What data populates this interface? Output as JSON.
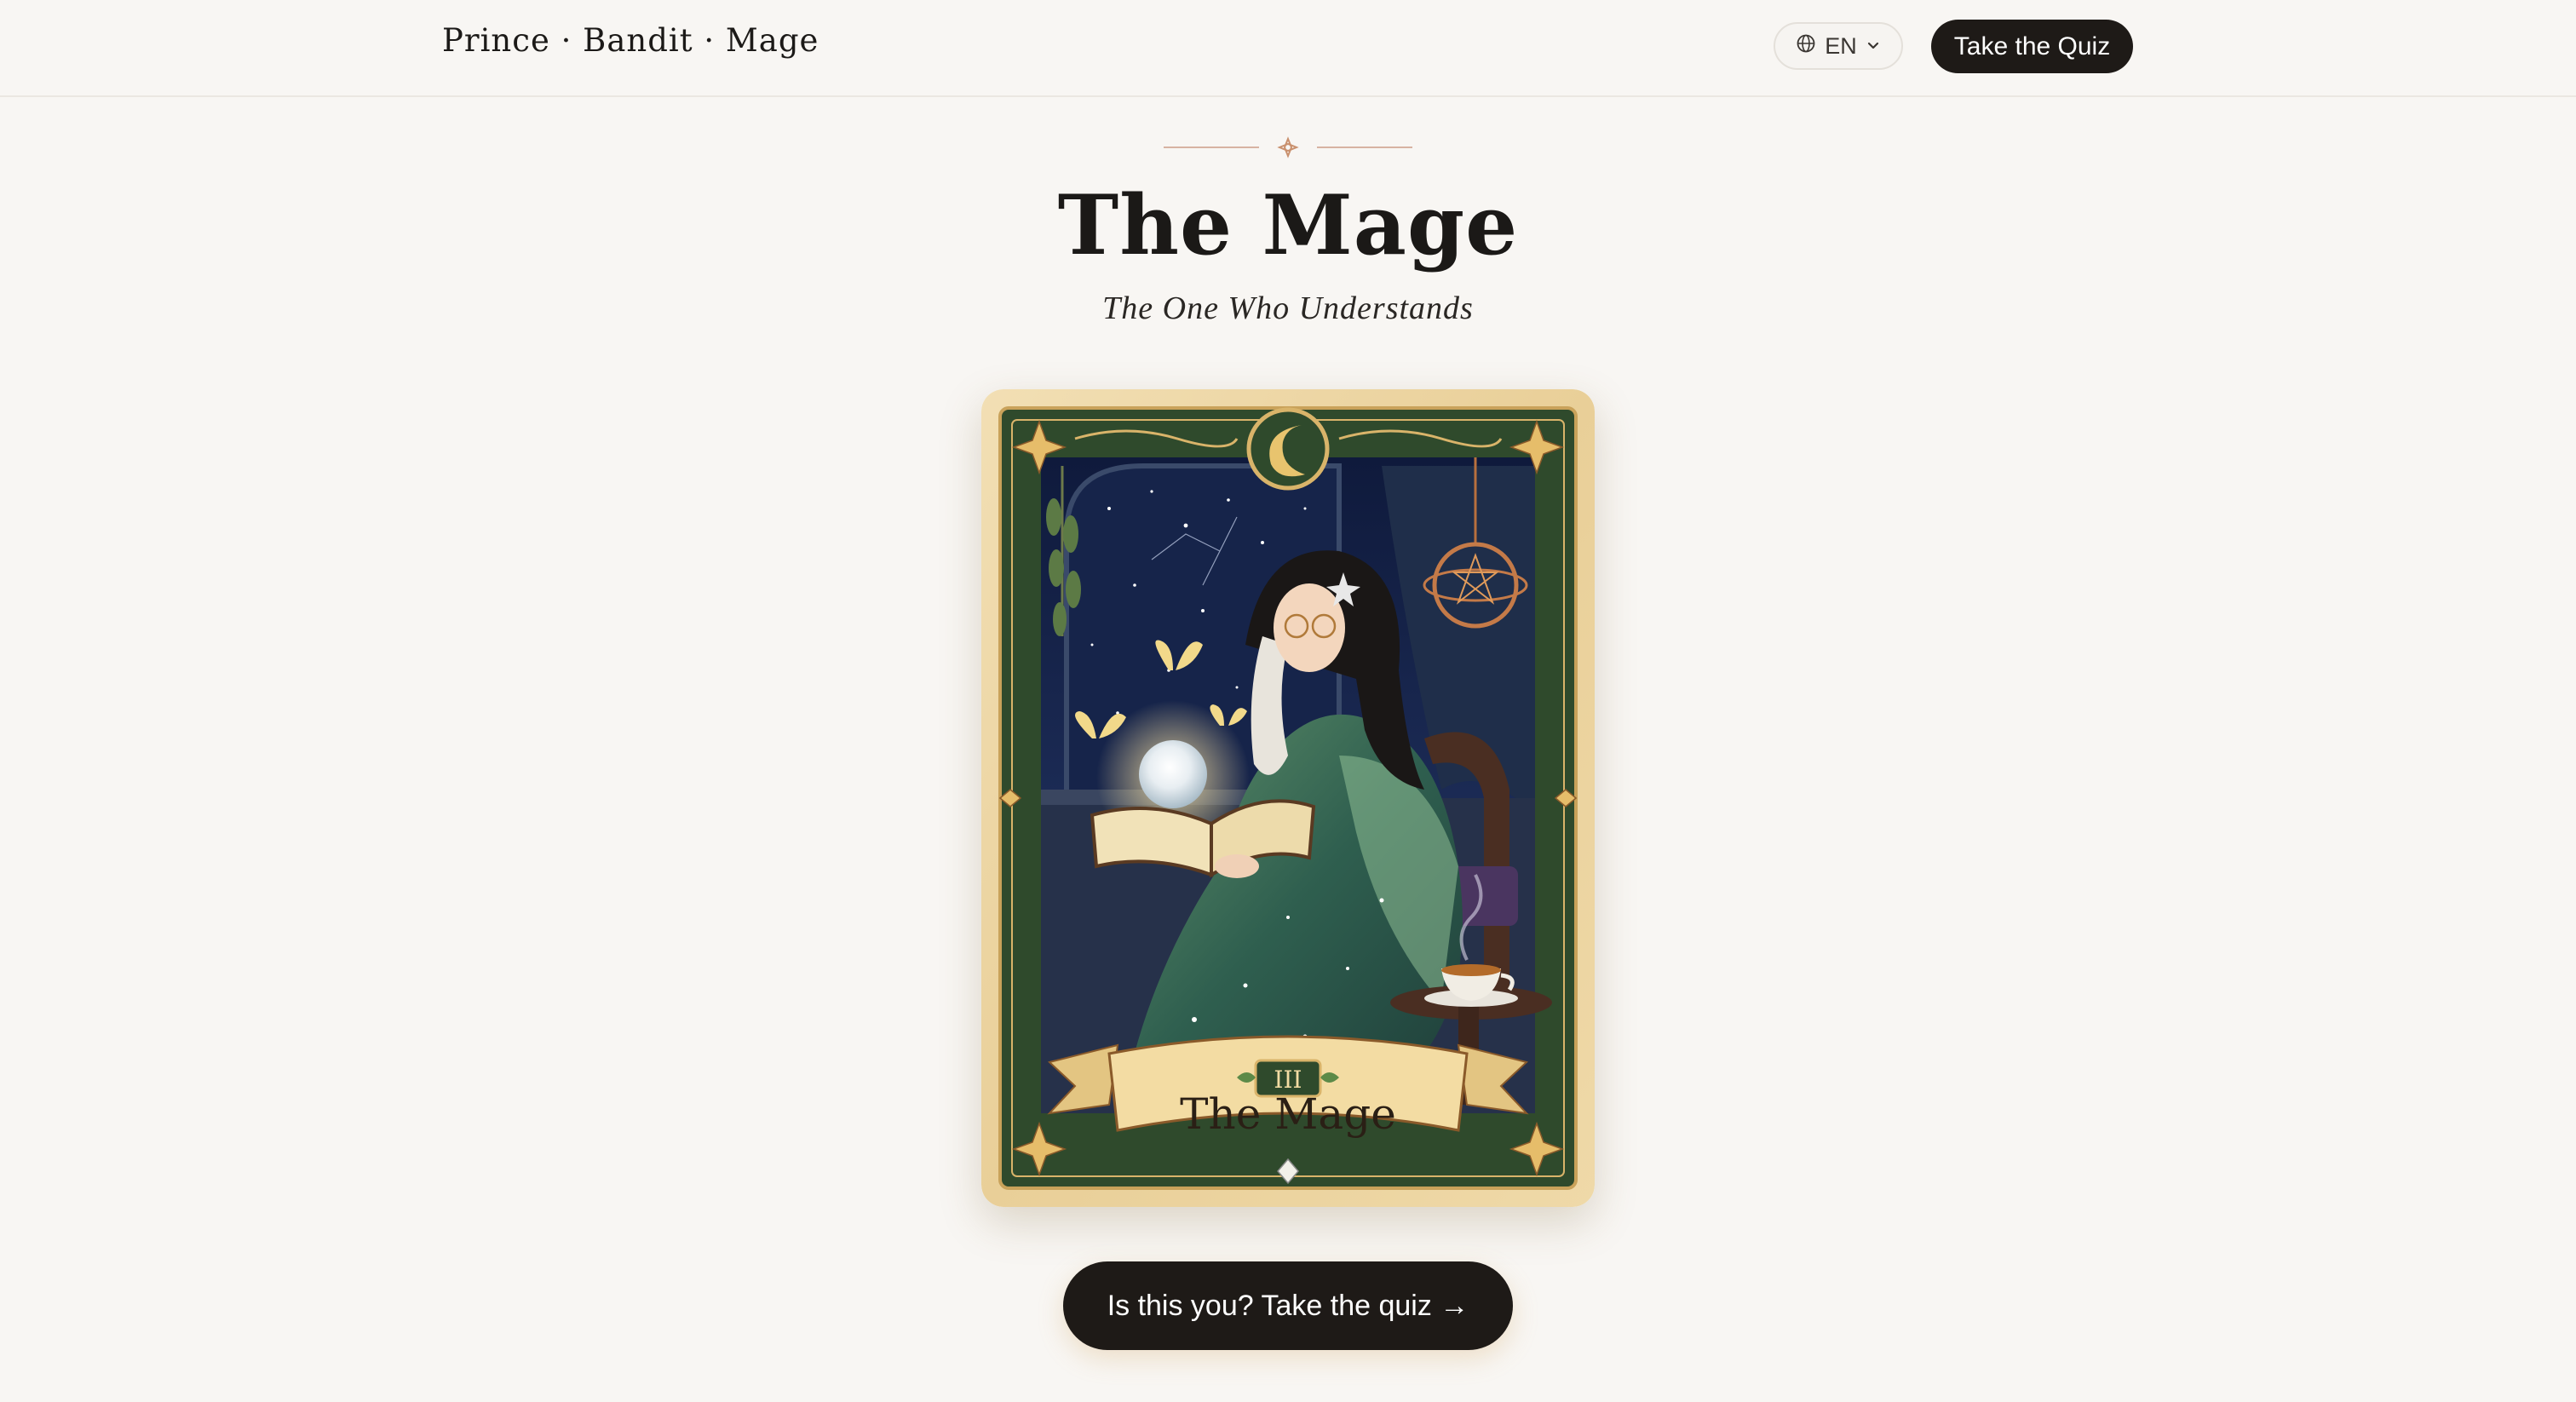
{
  "header": {
    "brand": "Prince · Bandit · Mage",
    "language": "EN",
    "quiz_button": "Take the Quiz"
  },
  "hero": {
    "title": "The Mage",
    "subtitle": "The One Who Understands"
  },
  "card": {
    "numeral": "III",
    "banner_title": "The Mage"
  },
  "cta": {
    "label": "Is this you? Take the quiz →"
  },
  "colors": {
    "background": "#f8f6f3",
    "button": "#1e1a17",
    "card_frame": "#2f4a2c",
    "card_gold": "#d9b46a",
    "ornament": "#c9906d"
  },
  "icons": {
    "language": "globe-icon",
    "language_caret": "chevron-down-icon",
    "divider": "sparkle-icon"
  }
}
